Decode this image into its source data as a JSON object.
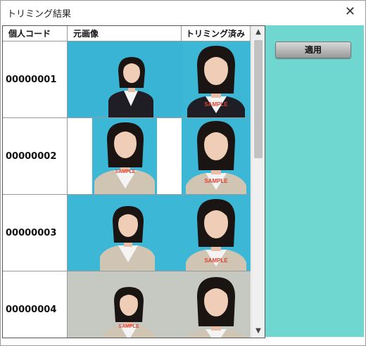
{
  "window": {
    "title": "トリミング結果"
  },
  "columns": {
    "code": "個人コード",
    "original": "元画像",
    "trimmed": "トリミング済み"
  },
  "rows": [
    {
      "code": "00000001",
      "bg": "#3cb7d6"
    },
    {
      "code": "00000002",
      "bg": "#3cb7d6"
    },
    {
      "code": "00000003",
      "bg": "#3cb7d6"
    },
    {
      "code": "00000004",
      "bg": "#c5c9c2"
    }
  ],
  "watermark": "SAMPLE",
  "buttons": {
    "apply": "適用"
  },
  "colors": {
    "panel": "#6fd7d0",
    "photo_bg": "#3cb7d6"
  }
}
